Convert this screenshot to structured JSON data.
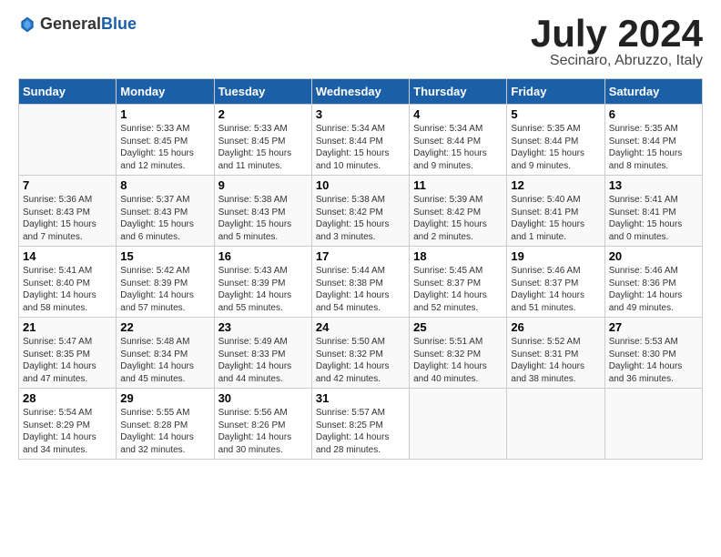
{
  "logo": {
    "general": "General",
    "blue": "Blue"
  },
  "header": {
    "month": "July 2024",
    "location": "Secinaro, Abruzzo, Italy"
  },
  "weekdays": [
    "Sunday",
    "Monday",
    "Tuesday",
    "Wednesday",
    "Thursday",
    "Friday",
    "Saturday"
  ],
  "weeks": [
    [
      {
        "day": "",
        "info": ""
      },
      {
        "day": "1",
        "info": "Sunrise: 5:33 AM\nSunset: 8:45 PM\nDaylight: 15 hours\nand 12 minutes."
      },
      {
        "day": "2",
        "info": "Sunrise: 5:33 AM\nSunset: 8:45 PM\nDaylight: 15 hours\nand 11 minutes."
      },
      {
        "day": "3",
        "info": "Sunrise: 5:34 AM\nSunset: 8:44 PM\nDaylight: 15 hours\nand 10 minutes."
      },
      {
        "day": "4",
        "info": "Sunrise: 5:34 AM\nSunset: 8:44 PM\nDaylight: 15 hours\nand 9 minutes."
      },
      {
        "day": "5",
        "info": "Sunrise: 5:35 AM\nSunset: 8:44 PM\nDaylight: 15 hours\nand 9 minutes."
      },
      {
        "day": "6",
        "info": "Sunrise: 5:35 AM\nSunset: 8:44 PM\nDaylight: 15 hours\nand 8 minutes."
      }
    ],
    [
      {
        "day": "7",
        "info": "Sunrise: 5:36 AM\nSunset: 8:43 PM\nDaylight: 15 hours\nand 7 minutes."
      },
      {
        "day": "8",
        "info": "Sunrise: 5:37 AM\nSunset: 8:43 PM\nDaylight: 15 hours\nand 6 minutes."
      },
      {
        "day": "9",
        "info": "Sunrise: 5:38 AM\nSunset: 8:43 PM\nDaylight: 15 hours\nand 5 minutes."
      },
      {
        "day": "10",
        "info": "Sunrise: 5:38 AM\nSunset: 8:42 PM\nDaylight: 15 hours\nand 3 minutes."
      },
      {
        "day": "11",
        "info": "Sunrise: 5:39 AM\nSunset: 8:42 PM\nDaylight: 15 hours\nand 2 minutes."
      },
      {
        "day": "12",
        "info": "Sunrise: 5:40 AM\nSunset: 8:41 PM\nDaylight: 15 hours\nand 1 minute."
      },
      {
        "day": "13",
        "info": "Sunrise: 5:41 AM\nSunset: 8:41 PM\nDaylight: 15 hours\nand 0 minutes."
      }
    ],
    [
      {
        "day": "14",
        "info": "Sunrise: 5:41 AM\nSunset: 8:40 PM\nDaylight: 14 hours\nand 58 minutes."
      },
      {
        "day": "15",
        "info": "Sunrise: 5:42 AM\nSunset: 8:39 PM\nDaylight: 14 hours\nand 57 minutes."
      },
      {
        "day": "16",
        "info": "Sunrise: 5:43 AM\nSunset: 8:39 PM\nDaylight: 14 hours\nand 55 minutes."
      },
      {
        "day": "17",
        "info": "Sunrise: 5:44 AM\nSunset: 8:38 PM\nDaylight: 14 hours\nand 54 minutes."
      },
      {
        "day": "18",
        "info": "Sunrise: 5:45 AM\nSunset: 8:37 PM\nDaylight: 14 hours\nand 52 minutes."
      },
      {
        "day": "19",
        "info": "Sunrise: 5:46 AM\nSunset: 8:37 PM\nDaylight: 14 hours\nand 51 minutes."
      },
      {
        "day": "20",
        "info": "Sunrise: 5:46 AM\nSunset: 8:36 PM\nDaylight: 14 hours\nand 49 minutes."
      }
    ],
    [
      {
        "day": "21",
        "info": "Sunrise: 5:47 AM\nSunset: 8:35 PM\nDaylight: 14 hours\nand 47 minutes."
      },
      {
        "day": "22",
        "info": "Sunrise: 5:48 AM\nSunset: 8:34 PM\nDaylight: 14 hours\nand 45 minutes."
      },
      {
        "day": "23",
        "info": "Sunrise: 5:49 AM\nSunset: 8:33 PM\nDaylight: 14 hours\nand 44 minutes."
      },
      {
        "day": "24",
        "info": "Sunrise: 5:50 AM\nSunset: 8:32 PM\nDaylight: 14 hours\nand 42 minutes."
      },
      {
        "day": "25",
        "info": "Sunrise: 5:51 AM\nSunset: 8:32 PM\nDaylight: 14 hours\nand 40 minutes."
      },
      {
        "day": "26",
        "info": "Sunrise: 5:52 AM\nSunset: 8:31 PM\nDaylight: 14 hours\nand 38 minutes."
      },
      {
        "day": "27",
        "info": "Sunrise: 5:53 AM\nSunset: 8:30 PM\nDaylight: 14 hours\nand 36 minutes."
      }
    ],
    [
      {
        "day": "28",
        "info": "Sunrise: 5:54 AM\nSunset: 8:29 PM\nDaylight: 14 hours\nand 34 minutes."
      },
      {
        "day": "29",
        "info": "Sunrise: 5:55 AM\nSunset: 8:28 PM\nDaylight: 14 hours\nand 32 minutes."
      },
      {
        "day": "30",
        "info": "Sunrise: 5:56 AM\nSunset: 8:26 PM\nDaylight: 14 hours\nand 30 minutes."
      },
      {
        "day": "31",
        "info": "Sunrise: 5:57 AM\nSunset: 8:25 PM\nDaylight: 14 hours\nand 28 minutes."
      },
      {
        "day": "",
        "info": ""
      },
      {
        "day": "",
        "info": ""
      },
      {
        "day": "",
        "info": ""
      }
    ]
  ]
}
